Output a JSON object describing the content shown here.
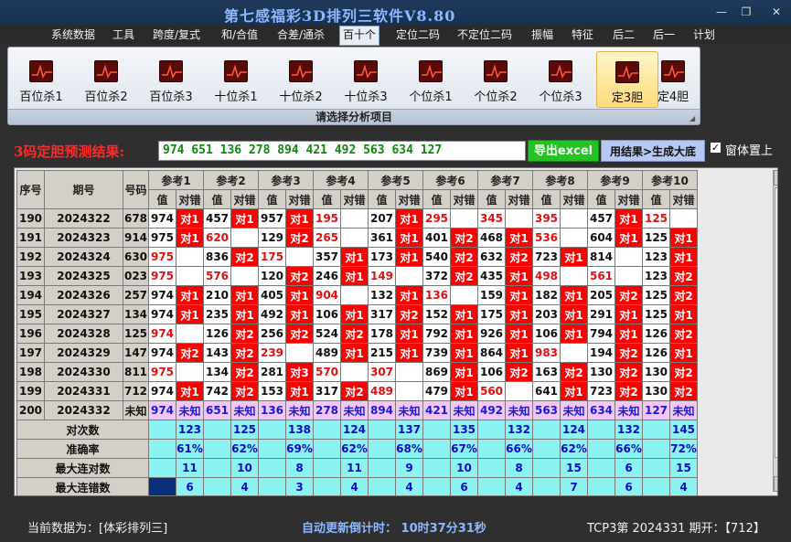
{
  "window": {
    "title": "第七感福彩3D排列三软件V8.80",
    "controls": [
      "—",
      "❐",
      "✕"
    ]
  },
  "menu": [
    "系统数据",
    "工具",
    "跨度/复式",
    "和/合值",
    "合差/通杀",
    "百十个",
    "定位二码",
    "不定位二码",
    "振幅",
    "特征",
    "后二",
    "后一",
    "计划"
  ],
  "menu_active": "百十个",
  "ribbon": {
    "buttons": [
      "百位杀1",
      "百位杀2",
      "百位杀3",
      "十位杀1",
      "十位杀2",
      "十位杀3",
      "个位杀1",
      "个位杀2",
      "个位杀3",
      "定3胆",
      "定4胆"
    ],
    "selected": "定3胆",
    "caption": "请选择分析项目"
  },
  "result": {
    "label": "3码定胆预测结果:",
    "value": "974 651 136 278 894 421 492 563 634 127",
    "export_button": "导出excel",
    "generate_button": "用结果>生成大底",
    "pin_checkbox_label": "窗体置上",
    "pin_checked": true
  },
  "grid": {
    "headers": {
      "seq": "序号",
      "period": "期号",
      "number": "号码",
      "groups": [
        "参考1",
        "参考2",
        "参考3",
        "参考4",
        "参考5",
        "参考6",
        "参考7",
        "参考8",
        "参考9",
        "参考10"
      ],
      "sub_value": "值",
      "sub_check": "对错"
    },
    "rows": [
      {
        "seq": "190",
        "period": "2024322",
        "number": "678",
        "refs": [
          [
            "974",
            "对1"
          ],
          [
            "457",
            "对1"
          ],
          [
            "957",
            "对1"
          ],
          [
            "195",
            ""
          ],
          [
            "207",
            "对1"
          ],
          [
            "295",
            ""
          ],
          [
            "345",
            ""
          ],
          [
            "395",
            ""
          ],
          [
            "457",
            "对1"
          ],
          [
            "125",
            ""
          ]
        ]
      },
      {
        "seq": "191",
        "period": "2024323",
        "number": "914",
        "refs": [
          [
            "975",
            "对1"
          ],
          [
            "620",
            ""
          ],
          [
            "129",
            "对2"
          ],
          [
            "265",
            ""
          ],
          [
            "361",
            "对1"
          ],
          [
            "401",
            "对2"
          ],
          [
            "468",
            "对1"
          ],
          [
            "536",
            ""
          ],
          [
            "604",
            "对1"
          ],
          [
            "125",
            "对1"
          ]
        ]
      },
      {
        "seq": "192",
        "period": "2024324",
        "number": "630",
        "refs": [
          [
            "975",
            ""
          ],
          [
            "836",
            "对2"
          ],
          [
            "175",
            ""
          ],
          [
            "357",
            "对1"
          ],
          [
            "173",
            "对1"
          ],
          [
            "540",
            "对2"
          ],
          [
            "632",
            "对2"
          ],
          [
            "723",
            "对1"
          ],
          [
            "814",
            ""
          ],
          [
            "123",
            "对1"
          ]
        ]
      },
      {
        "seq": "193",
        "period": "2024325",
        "number": "023",
        "refs": [
          [
            "975",
            ""
          ],
          [
            "576",
            ""
          ],
          [
            "120",
            "对2"
          ],
          [
            "246",
            "对1"
          ],
          [
            "149",
            ""
          ],
          [
            "372",
            "对2"
          ],
          [
            "435",
            "对1"
          ],
          [
            "498",
            ""
          ],
          [
            "561",
            ""
          ],
          [
            "123",
            "对2"
          ]
        ]
      },
      {
        "seq": "194",
        "period": "2024326",
        "number": "257",
        "refs": [
          [
            "974",
            "对1"
          ],
          [
            "210",
            "对1"
          ],
          [
            "405",
            "对1"
          ],
          [
            "904",
            ""
          ],
          [
            "132",
            "对1"
          ],
          [
            "136",
            ""
          ],
          [
            "159",
            "对1"
          ],
          [
            "182",
            "对1"
          ],
          [
            "205",
            "对2"
          ],
          [
            "125",
            "对2"
          ]
        ]
      },
      {
        "seq": "195",
        "period": "2024327",
        "number": "134",
        "refs": [
          [
            "974",
            "对1"
          ],
          [
            "235",
            "对1"
          ],
          [
            "492",
            "对1"
          ],
          [
            "106",
            "对1"
          ],
          [
            "317",
            "对2"
          ],
          [
            "152",
            "对1"
          ],
          [
            "175",
            "对1"
          ],
          [
            "203",
            "对1"
          ],
          [
            "291",
            "对1"
          ],
          [
            "125",
            "对1"
          ]
        ]
      },
      {
        "seq": "196",
        "period": "2024328",
        "number": "125",
        "refs": [
          [
            "974",
            ""
          ],
          [
            "126",
            "对2"
          ],
          [
            "256",
            "对2"
          ],
          [
            "524",
            "对2"
          ],
          [
            "178",
            "对1"
          ],
          [
            "792",
            "对1"
          ],
          [
            "926",
            "对1"
          ],
          [
            "106",
            "对1"
          ],
          [
            "794",
            "对1"
          ],
          [
            "126",
            "对2"
          ]
        ]
      },
      {
        "seq": "197",
        "period": "2024329",
        "number": "147",
        "refs": [
          [
            "974",
            "对2"
          ],
          [
            "143",
            "对2"
          ],
          [
            "239",
            ""
          ],
          [
            "489",
            "对1"
          ],
          [
            "215",
            "对1"
          ],
          [
            "739",
            "对1"
          ],
          [
            "864",
            "对1"
          ],
          [
            "983",
            ""
          ],
          [
            "194",
            "对2"
          ],
          [
            "126",
            "对1"
          ]
        ]
      },
      {
        "seq": "198",
        "period": "2024330",
        "number": "811",
        "refs": [
          [
            "975",
            ""
          ],
          [
            "134",
            "对2"
          ],
          [
            "281",
            "对3"
          ],
          [
            "570",
            ""
          ],
          [
            "307",
            ""
          ],
          [
            "869",
            "对1"
          ],
          [
            "106",
            "对2"
          ],
          [
            "163",
            "对2"
          ],
          [
            "130",
            "对2"
          ],
          [
            "130",
            "对2"
          ]
        ]
      },
      {
        "seq": "199",
        "period": "2024331",
        "number": "712",
        "refs": [
          [
            "974",
            "对1"
          ],
          [
            "742",
            "对2"
          ],
          [
            "153",
            "对1"
          ],
          [
            "317",
            "对2"
          ],
          [
            "489",
            ""
          ],
          [
            "479",
            "对1"
          ],
          [
            "560",
            ""
          ],
          [
            "641",
            "对1"
          ],
          [
            "723",
            "对2"
          ],
          [
            "130",
            "对2"
          ]
        ]
      }
    ],
    "last_row": {
      "seq": "200",
      "period": "2024332",
      "number": "未知",
      "refs": [
        [
          "974",
          "未知"
        ],
        [
          "651",
          "未知"
        ],
        [
          "136",
          "未知"
        ],
        [
          "278",
          "未知"
        ],
        [
          "894",
          "未知"
        ],
        [
          "421",
          "未知"
        ],
        [
          "492",
          "未知"
        ],
        [
          "563",
          "未知"
        ],
        [
          "634",
          "未知"
        ],
        [
          "127",
          "未知"
        ]
      ]
    },
    "red_value_cells": {
      "190": [
        3,
        5,
        6,
        7,
        9
      ],
      "191": [
        1,
        3,
        7
      ],
      "192": [
        0,
        2
      ],
      "193": [
        0,
        1,
        4,
        7,
        8
      ],
      "194": [
        3,
        5
      ],
      "195": [],
      "196": [
        0
      ],
      "197": [
        2,
        7
      ],
      "198": [
        0,
        3,
        4
      ],
      "199": [
        4,
        6
      ]
    },
    "stats": [
      {
        "label": "对次数",
        "values": [
          "123",
          "125",
          "138",
          "124",
          "137",
          "135",
          "132",
          "124",
          "132",
          "145"
        ]
      },
      {
        "label": "准确率",
        "values": [
          "61%",
          "62%",
          "69%",
          "62%",
          "68%",
          "67%",
          "66%",
          "62%",
          "66%",
          "72%"
        ]
      },
      {
        "label": "最大连对数",
        "values": [
          "11",
          "10",
          "8",
          "11",
          "9",
          "10",
          "8",
          "15",
          "6",
          "15"
        ]
      },
      {
        "label": "最大连错数",
        "values": [
          "6",
          "4",
          "3",
          "4",
          "4",
          "6",
          "4",
          "7",
          "6",
          "4"
        ]
      }
    ]
  },
  "status": {
    "current_data": "当前数据为：[体彩排列三]",
    "countdown": "自动更新倒计时：  10时37分31秒",
    "period_info": "TCP3第 2024331 期开：【712】"
  },
  "colors": {
    "hit_bg": "#ff0000",
    "stat_bg": "#8cf3f3",
    "last_row_bg": "#f3c6f3",
    "accent_red": "#ff2a2a",
    "result_green": "#0b8a0b"
  }
}
